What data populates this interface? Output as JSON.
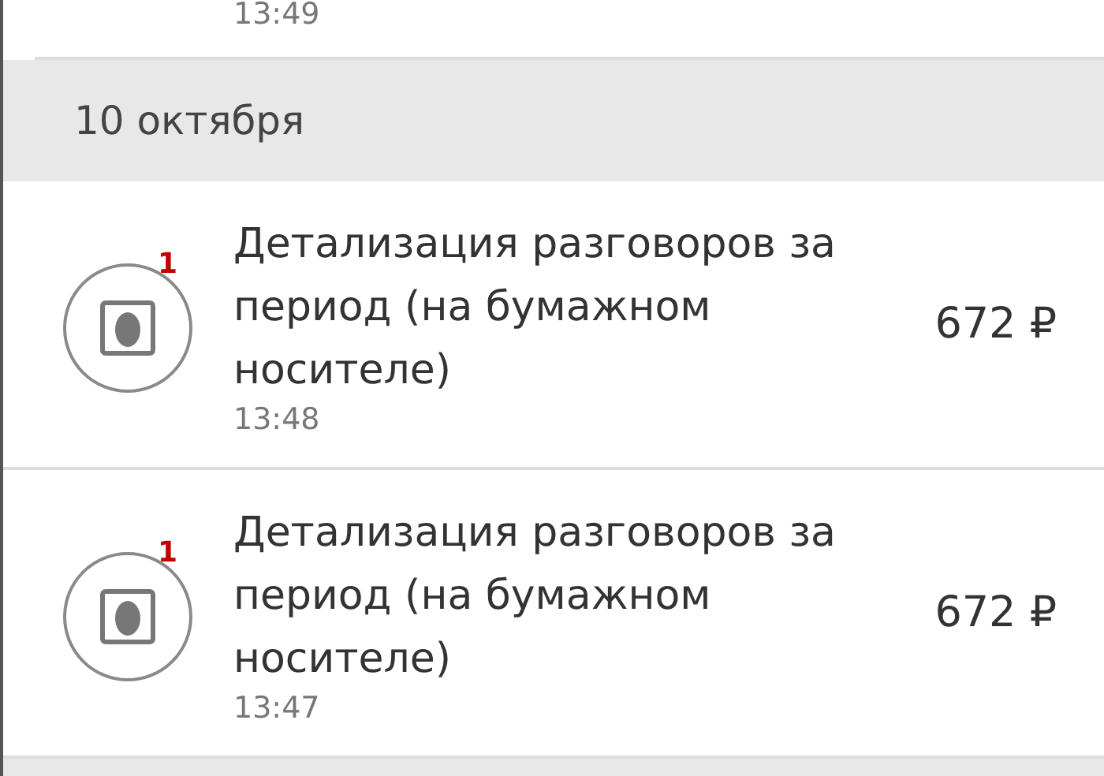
{
  "previous_item": {
    "time": "13:49"
  },
  "date_header": "10 октября",
  "items": [
    {
      "title": "Детализация разговоров за период (на бумажном носителе)",
      "time": "13:48",
      "amount": "672 ₽",
      "badge": "1"
    },
    {
      "title": "Детализация разговоров за период (на бумажном носителе)",
      "time": "13:47",
      "amount": "672 ₽",
      "badge": "1"
    }
  ]
}
